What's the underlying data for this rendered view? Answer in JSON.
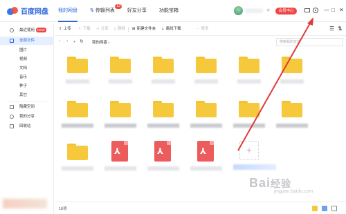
{
  "app": {
    "name": "百度网盘"
  },
  "nav": {
    "items": [
      {
        "label": "我的网盘",
        "active": true
      },
      {
        "label": "传输列表",
        "badge": "13"
      },
      {
        "label": "好友分享"
      },
      {
        "label": "功能宝箱"
      }
    ]
  },
  "header": {
    "vip_label": "会员中心",
    "star_icon": "star-icon",
    "mail_icon": "mail-icon",
    "gear_icon": "gear-icon",
    "minimize": "—",
    "maximize": "□",
    "close": "✕"
  },
  "sidebar": {
    "recent": {
      "label": "最近使用",
      "badge": "NEW"
    },
    "all_files": {
      "label": "全部文件"
    },
    "categories": [
      "图片",
      "视频",
      "文档",
      "音乐",
      "种子",
      "其它"
    ],
    "hidden": {
      "label": "隐藏空间"
    },
    "shares": {
      "label": "我的分享"
    },
    "trash": {
      "label": "回收站"
    }
  },
  "toolbar": {
    "upload": "上传",
    "download": "下载",
    "share": "分享",
    "delete": "删除",
    "new_folder": "新建文件夹",
    "offline_download": "离线下载",
    "more": "更多"
  },
  "address": {
    "breadcrumb": "我的网盘",
    "search_placeholder": "搜索我的文件"
  },
  "grid": {
    "rows": [
      [
        "folder",
        "folder",
        "folder",
        "folder",
        "folder",
        "folder"
      ],
      [
        "folder",
        "folder",
        "folder",
        "folder",
        "folder",
        "folder"
      ],
      [
        "folder",
        "pdf",
        "pdf",
        "pdf",
        "add"
      ]
    ],
    "add_symbol": "+"
  },
  "status": {
    "count": "18项"
  },
  "watermark": {
    "brand": "Bai",
    "brand_tail": "经验",
    "sub": "jingyan.baidu.com"
  },
  "colors": {
    "accent": "#2b67d8",
    "folder": "#f6c93c",
    "pdf": "#ed5c5c",
    "annotation": "#e03a3a"
  }
}
